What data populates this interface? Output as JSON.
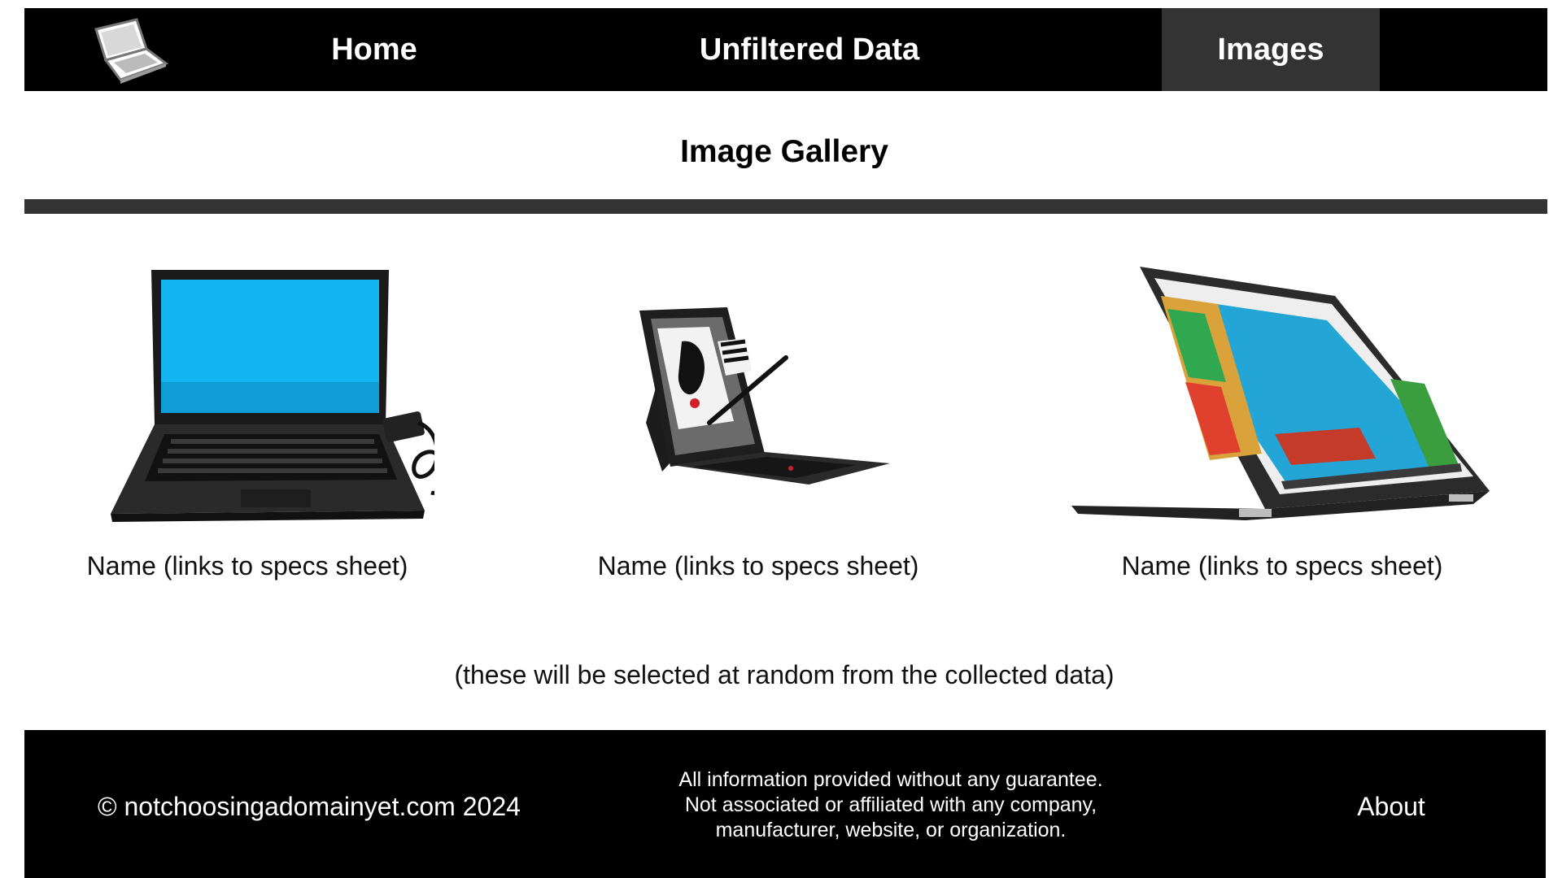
{
  "nav": {
    "logo_icon": "laptop-icon",
    "items": [
      {
        "label": "Home"
      },
      {
        "label": "Unfiltered Data"
      },
      {
        "label": "Images",
        "active": true
      }
    ],
    "active_bg": "#333333"
  },
  "main": {
    "title": "Image Gallery",
    "gallery": [
      {
        "caption": "Name (links to specs sheet)",
        "image": "laptop-thinkpad-image"
      },
      {
        "caption": "Name (links to specs sheet)",
        "image": "tablet-x1-image"
      },
      {
        "caption": "Name (links to specs sheet)",
        "image": "convertible-yoga-image"
      }
    ],
    "note": "(these will be selected at random from the collected data)"
  },
  "footer": {
    "copyright": "© notchoosingadomainyet.com 2024",
    "disclaimer": [
      "All information provided without any guarantee.",
      "Not associated or affiliated with any company,",
      "manufacturer, website, or organization."
    ],
    "about": "About"
  },
  "colors": {
    "nav_bg": "#000000",
    "divider": "#333333",
    "footer_bg": "#000000",
    "text": "#111111"
  }
}
